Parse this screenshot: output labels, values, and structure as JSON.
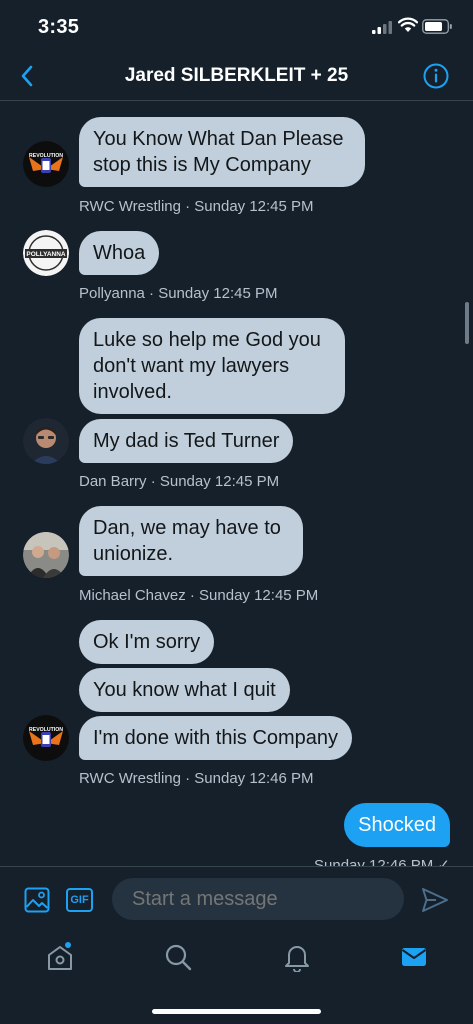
{
  "status_bar": {
    "time": "3:35"
  },
  "header": {
    "title": "Jared SILBERKLEIT + 25"
  },
  "avatars": {
    "revolution_text_top": "REVOLUTION",
    "pollyanna_text": "POLLYANNA"
  },
  "messages": [
    {
      "text": "You Know What Dan Please\nstop this is My Company"
    },
    {
      "meta": "RWC Wrestling  · Sunday 12:45 PM"
    },
    {
      "text": "Whoa"
    },
    {
      "meta": "Pollyanna  · Sunday 12:45 PM"
    },
    {
      "text": "Luke so help me God you\ndon't want my lawyers\ninvolved."
    },
    {
      "text": "My dad is Ted Turner"
    },
    {
      "meta": "Dan Barry  · Sunday 12:45 PM"
    },
    {
      "text": "Dan, we may have to\nunionize."
    },
    {
      "meta": "Michael Chavez  · Sunday 12:45 PM"
    },
    {
      "text": "Ok I'm sorry"
    },
    {
      "text": "You know what I quit"
    },
    {
      "text": "I'm done with this Company"
    },
    {
      "meta": "RWC Wrestling  · Sunday 12:46 PM"
    },
    {
      "text": "Shocked"
    },
    {
      "meta": "Sunday 12:46 PM ✓"
    }
  ],
  "composer": {
    "gif_label": "GIF",
    "placeholder": "Start a message"
  },
  "icons": {
    "back": "chevron-left-icon",
    "info": "info-icon",
    "image": "image-icon",
    "send": "send-icon",
    "home": "home-icon",
    "search": "search-icon",
    "notifications": "bell-icon",
    "messages": "mail-icon"
  },
  "colors": {
    "background": "#15202b",
    "accent": "#1da1f2",
    "bubble": "#c0cfdb",
    "meta_text": "#b5c1cc"
  }
}
